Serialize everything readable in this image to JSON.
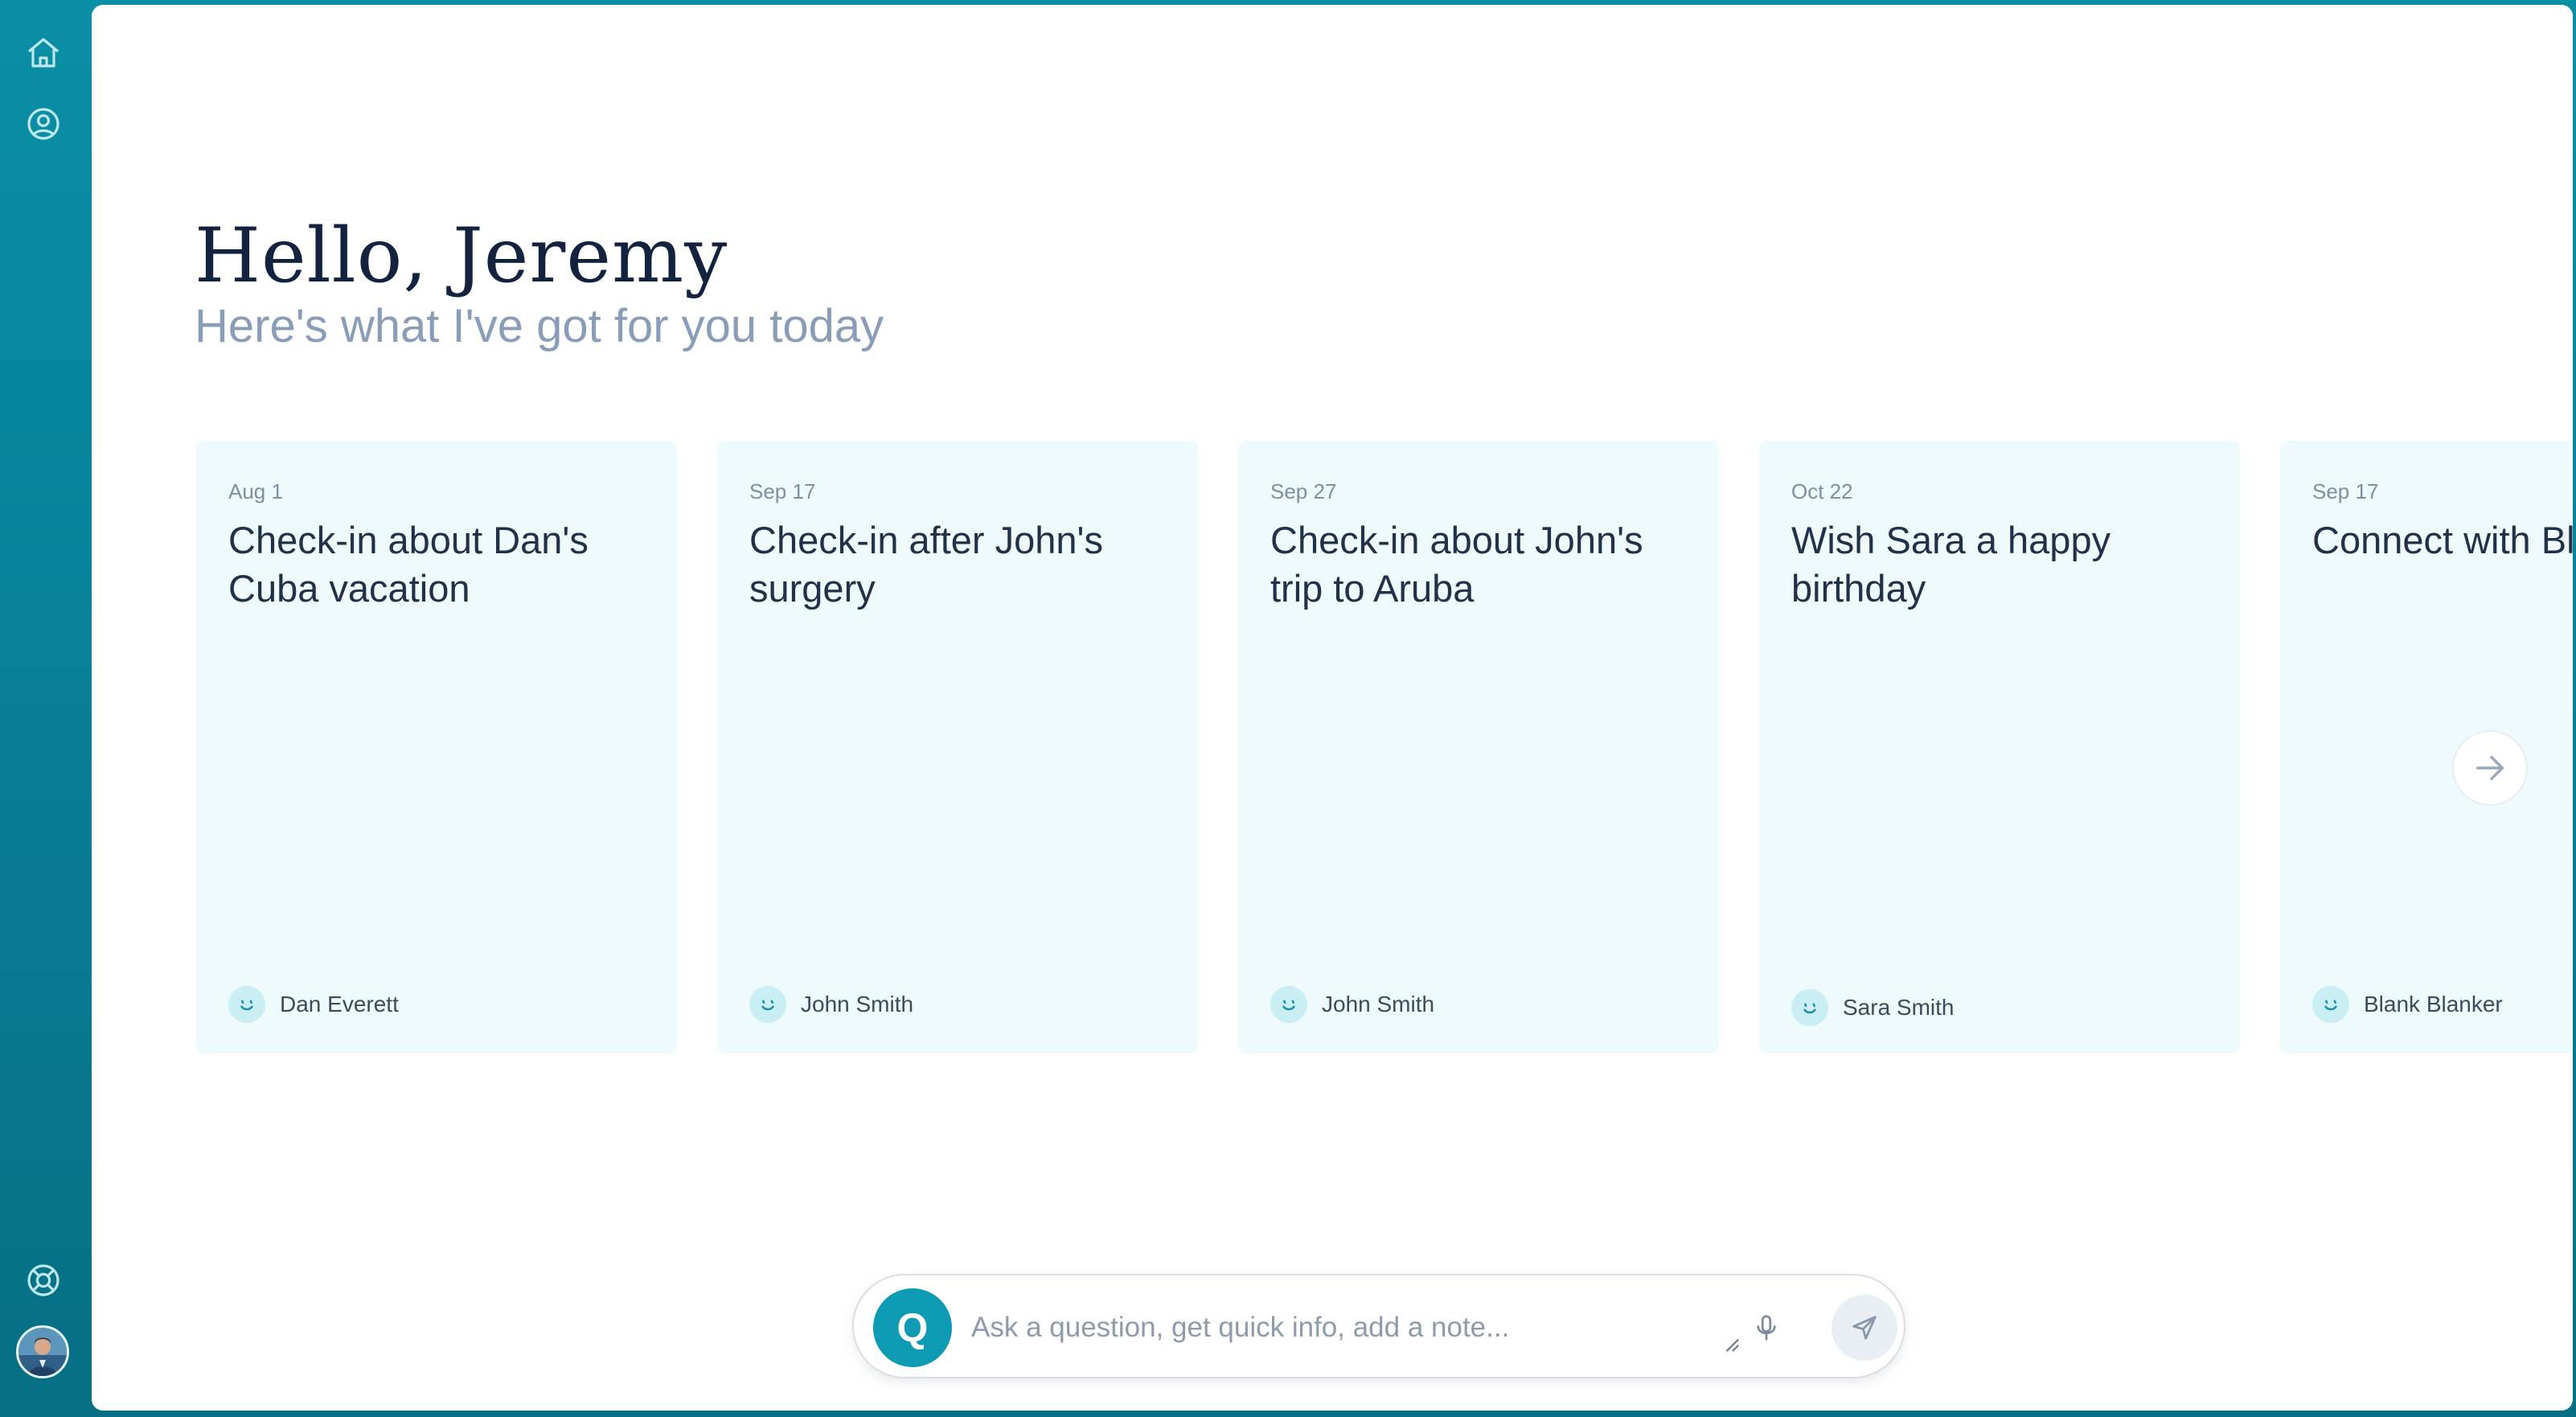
{
  "rail": {
    "icons": [
      "home-icon",
      "profile-icon",
      "help-icon"
    ],
    "user_avatar": "user-avatar"
  },
  "header": {
    "greeting": "Hello, Jeremy",
    "subtitle": "Here's what I've got for you today"
  },
  "cards": [
    {
      "date": "Aug 1",
      "title": "Check-in about Dan's Cuba vacation",
      "person": "Dan Everett"
    },
    {
      "date": "Sep 17",
      "title": "Check-in after John's surgery",
      "person": "John Smith"
    },
    {
      "date": "Sep 27",
      "title": "Check-in about John's trip to Aruba",
      "person": "John Smith"
    },
    {
      "date": "Oct 22",
      "title": "Wish Sara a happy birthday",
      "person": "Sara Smith"
    },
    {
      "date": "Sep 17",
      "title": "Connect with Blank",
      "person": "Blank Blanker"
    }
  ],
  "ask": {
    "logo_letter": "Q",
    "placeholder": "Ask a question, get quick info, add a note..."
  },
  "colors": {
    "sidebar": "#0a8fa6",
    "card_bg": "#eefafb",
    "accent": "#0d9bb4",
    "heading": "#13233f",
    "subtitle": "#8a9db8"
  }
}
